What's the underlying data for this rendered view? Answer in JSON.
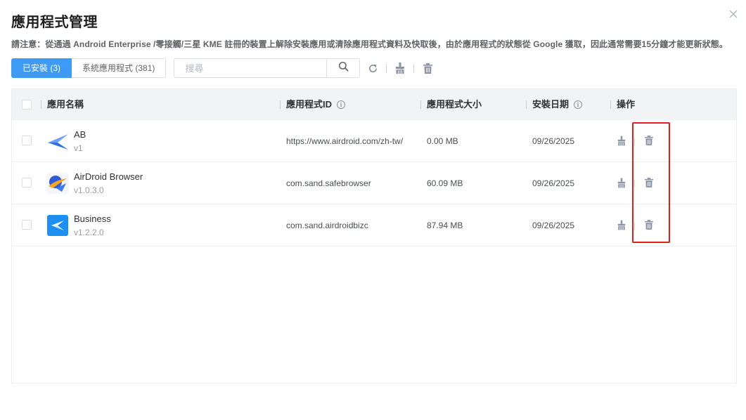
{
  "dialog": {
    "title": "應用程式管理",
    "notice": "請注意：從通過 Android Enterprise /零接觸/三星 KME 註冊的裝置上解除安裝應用或清除應用程式資料及快取後，由於應用程式的狀態從 Google 獲取，因此通常需要15分鐘才能更新狀態。"
  },
  "tabs": [
    {
      "label": "已安裝 (3)",
      "active": true
    },
    {
      "label": "系統應用程式 (381)",
      "active": false
    }
  ],
  "search": {
    "placeholder": "搜尋",
    "value": ""
  },
  "table": {
    "columns": {
      "name": "應用名稱",
      "app_id": "應用程式ID",
      "size": "應用程式大小",
      "date": "安裝日期",
      "actions": "操作"
    },
    "rows": [
      {
        "name": "AB",
        "version": "v1",
        "app_id": "https://www.airdroid.com/zh-tw/",
        "size": "0.00 MB",
        "date": "09/26/2025",
        "icon": "ab-app-icon"
      },
      {
        "name": "AirDroid Browser",
        "version": "v1.0.3.0",
        "app_id": "com.sand.safebrowser",
        "size": "60.09 MB",
        "date": "09/26/2025",
        "icon": "airdroid-browser-app-icon"
      },
      {
        "name": "Business",
        "version": "v1.2.2.0",
        "app_id": "com.sand.airdroidbizc",
        "size": "87.94 MB",
        "date": "09/26/2025",
        "icon": "business-app-icon"
      }
    ]
  },
  "icons": {
    "close": "close-icon",
    "search": "search-icon",
    "refresh": "refresh-icon",
    "clear": "broom-icon",
    "delete": "trash-icon",
    "info": "info-icon"
  },
  "colors": {
    "primary": "#3d9bf5",
    "highlight": "#e02020",
    "header_bg": "#f2f3f5",
    "icon_gray": "#8a94a6"
  }
}
